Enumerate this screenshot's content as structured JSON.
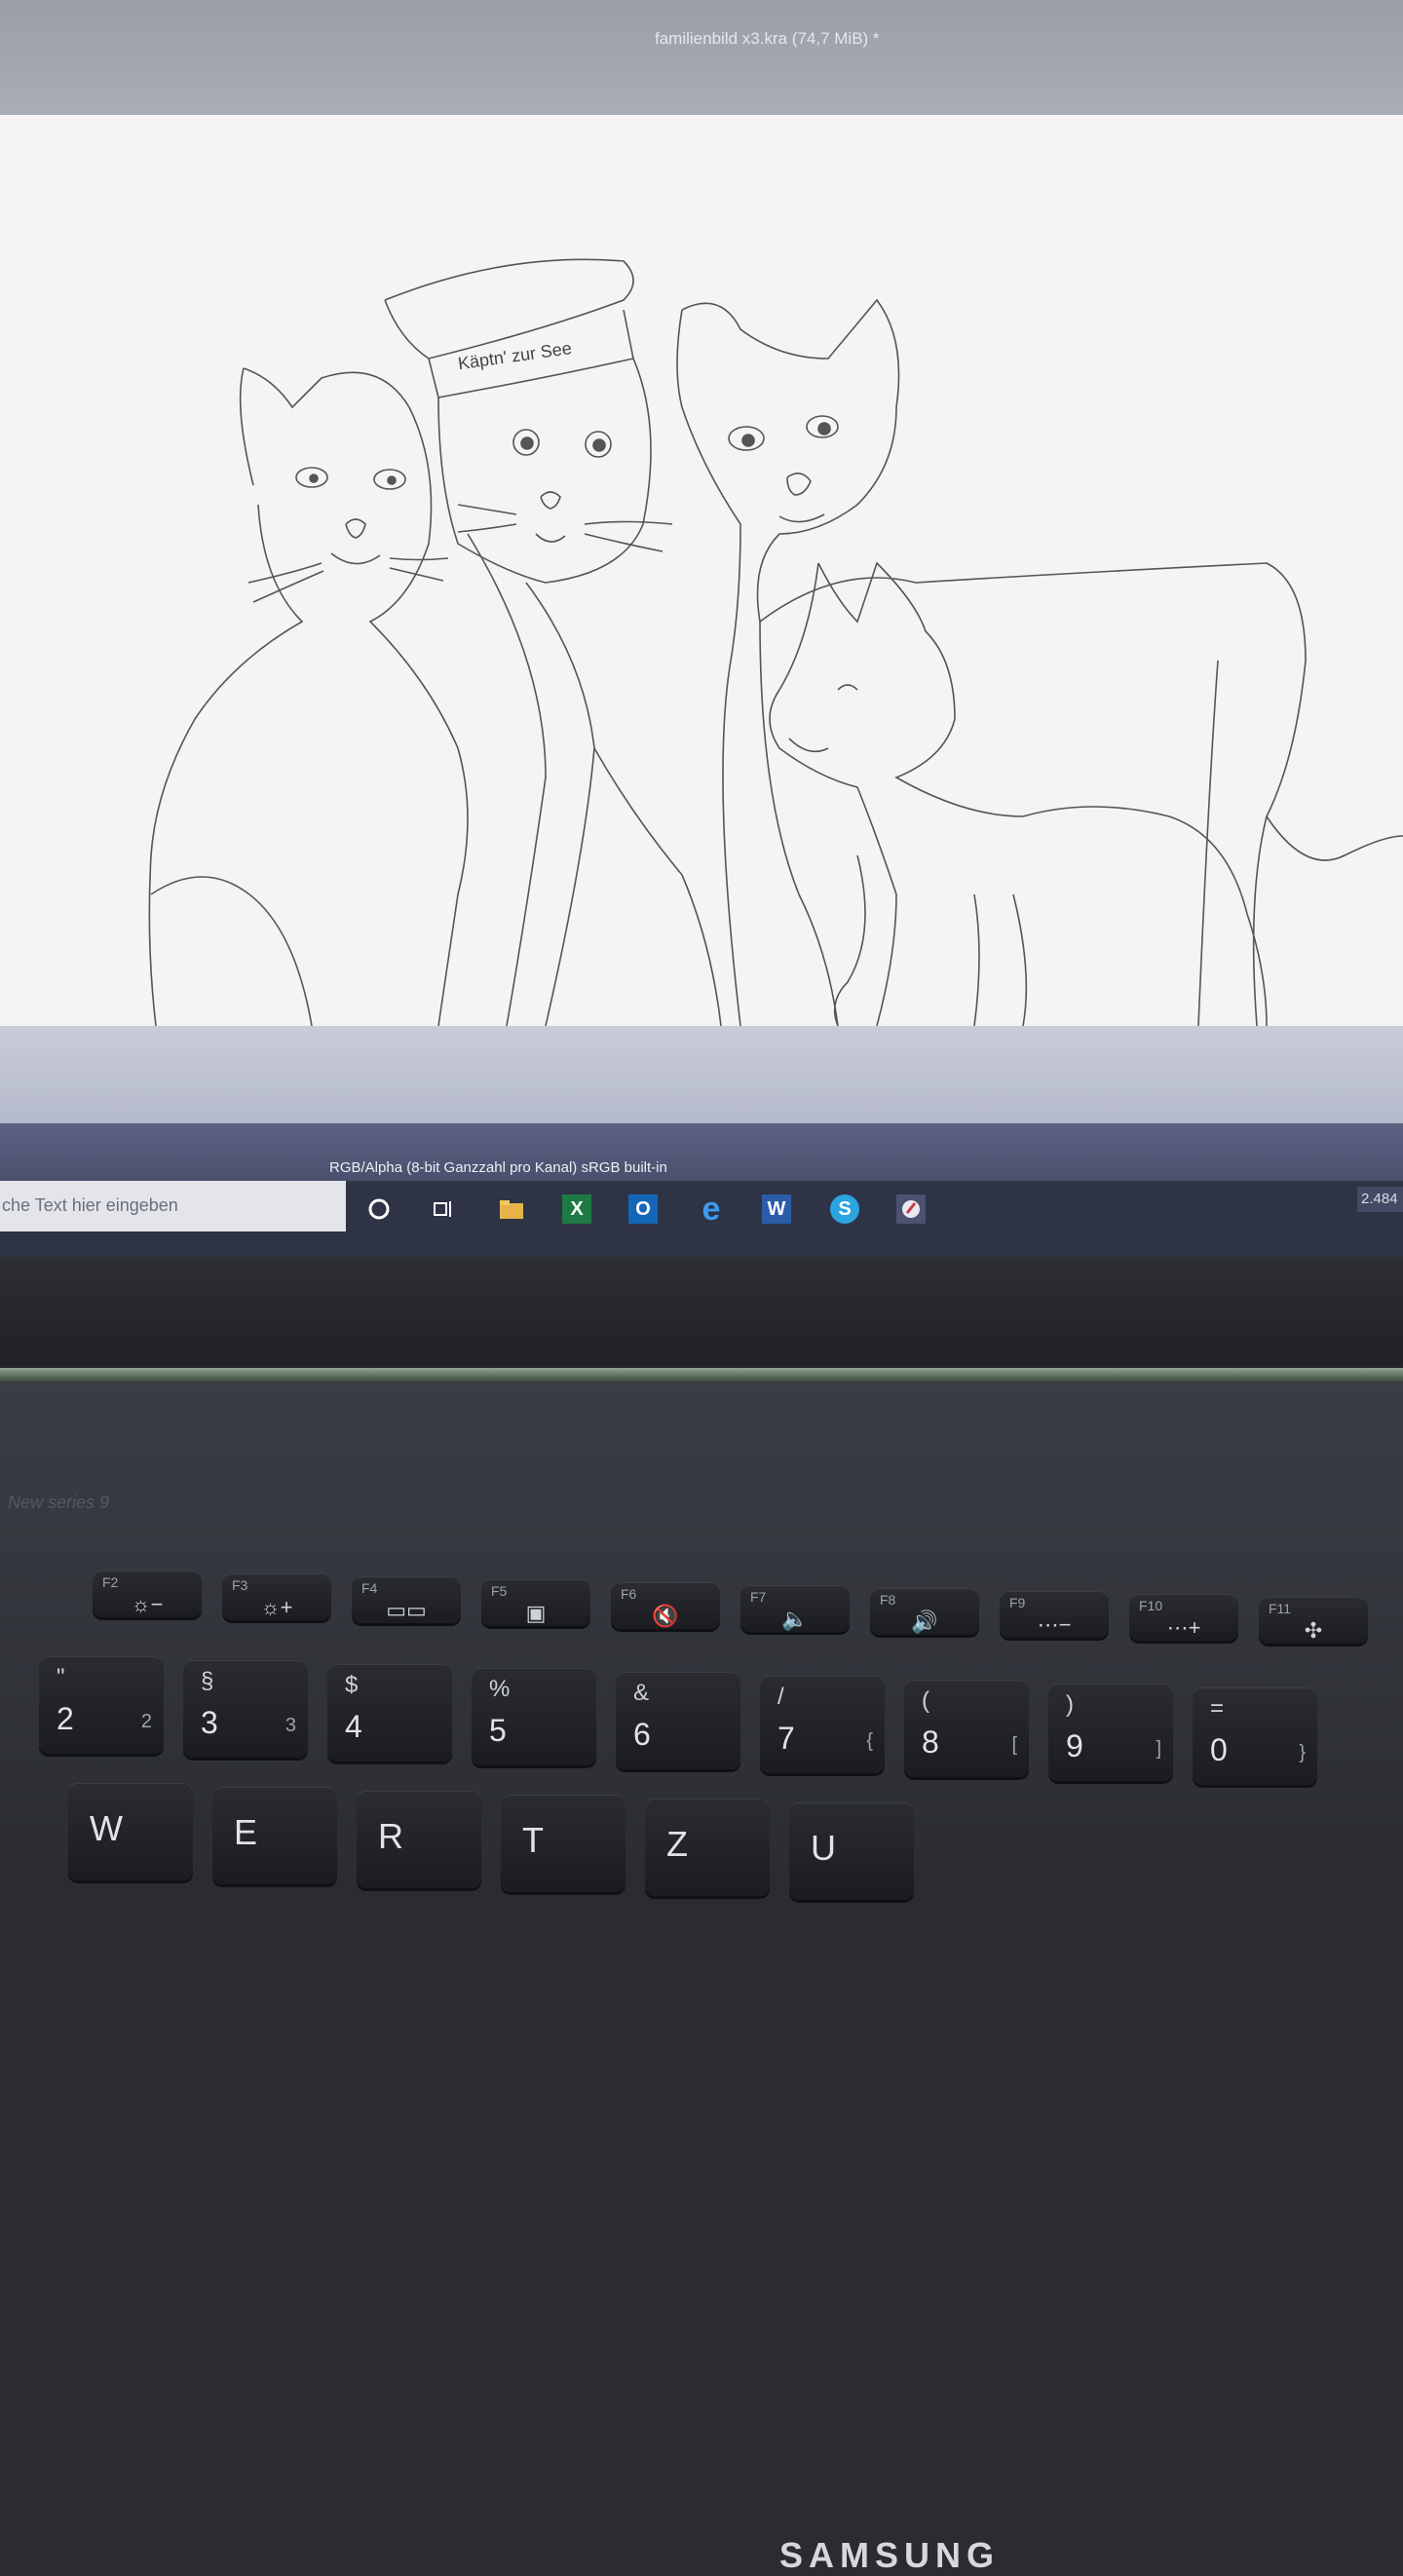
{
  "window": {
    "title": "familienbild x3.kra (74,7 MiB) *"
  },
  "canvas": {
    "hat_text": "Käptn' zur See"
  },
  "status": {
    "color_profile": "RGB/Alpha (8-bit Ganzzahl pro Kanal)  sRGB built-in",
    "zoom": "2.484"
  },
  "taskbar": {
    "search_placeholder": "che Text hier eingeben",
    "icons": [
      "cortana-icon",
      "task-view-icon",
      "file-explorer-icon",
      "excel-icon",
      "outlook-icon",
      "edge-icon",
      "word-icon",
      "skype-icon",
      "krita-icon"
    ]
  },
  "laptop": {
    "brand": "SAMSUNG",
    "model": "New series 9"
  },
  "keyboard": {
    "function_row": [
      {
        "label": "F2",
        "glyph": "☼−"
      },
      {
        "label": "F3",
        "glyph": "☼+"
      },
      {
        "label": "F4",
        "glyph": "▭▭"
      },
      {
        "label": "F5",
        "glyph": "▣"
      },
      {
        "label": "F6",
        "glyph": "🔇"
      },
      {
        "label": "F7",
        "glyph": "🔈"
      },
      {
        "label": "F8",
        "glyph": "🔊"
      },
      {
        "label": "F9",
        "glyph": "⋯−"
      },
      {
        "label": "F10",
        "glyph": "⋯+"
      },
      {
        "label": "F11",
        "glyph": "✣"
      }
    ],
    "number_row": [
      {
        "top": "\"",
        "main": "2",
        "alt": "2"
      },
      {
        "top": "§",
        "main": "3",
        "alt": "3"
      },
      {
        "top": "$",
        "main": "4",
        "alt": ""
      },
      {
        "top": "%",
        "main": "5",
        "alt": ""
      },
      {
        "top": "&",
        "main": "6",
        "alt": ""
      },
      {
        "top": "/",
        "main": "7",
        "alt": "{"
      },
      {
        "top": "(",
        "main": "8",
        "alt": "["
      },
      {
        "top": ")",
        "main": "9",
        "alt": "]"
      },
      {
        "top": "=",
        "main": "0",
        "alt": "}"
      }
    ],
    "letter_row": [
      "W",
      "E",
      "R",
      "T",
      "Z",
      "U"
    ]
  },
  "colors": {
    "canvas": "#f5f3f3",
    "statusbar": "#5d6383",
    "taskbar": "#2e3346",
    "bezel": "#2c2e33"
  }
}
